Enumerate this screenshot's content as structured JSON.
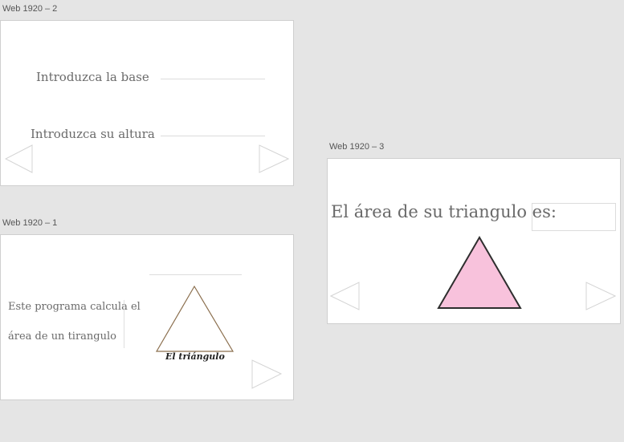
{
  "artboards": [
    {
      "label": "Web 1920 – 2"
    },
    {
      "label": "Web 1920 – 1"
    },
    {
      "label": "Web 1920 – 3"
    }
  ],
  "screen2": {
    "base_label": "Introduzca la base",
    "height_label": "Introduzca su altura",
    "base_value": "",
    "height_value": ""
  },
  "screen1": {
    "intro_line1": "Este programa calcula el",
    "intro_line2": "área de un tirangulo",
    "caption": "El triángulo"
  },
  "screen3": {
    "result_label": "El área de su triangulo es:",
    "result_value": ""
  },
  "colors": {
    "canvas": "#e5e5e5",
    "triangle_fill": "#f8c2dc",
    "triangle_outline": "#8b6f4e"
  }
}
